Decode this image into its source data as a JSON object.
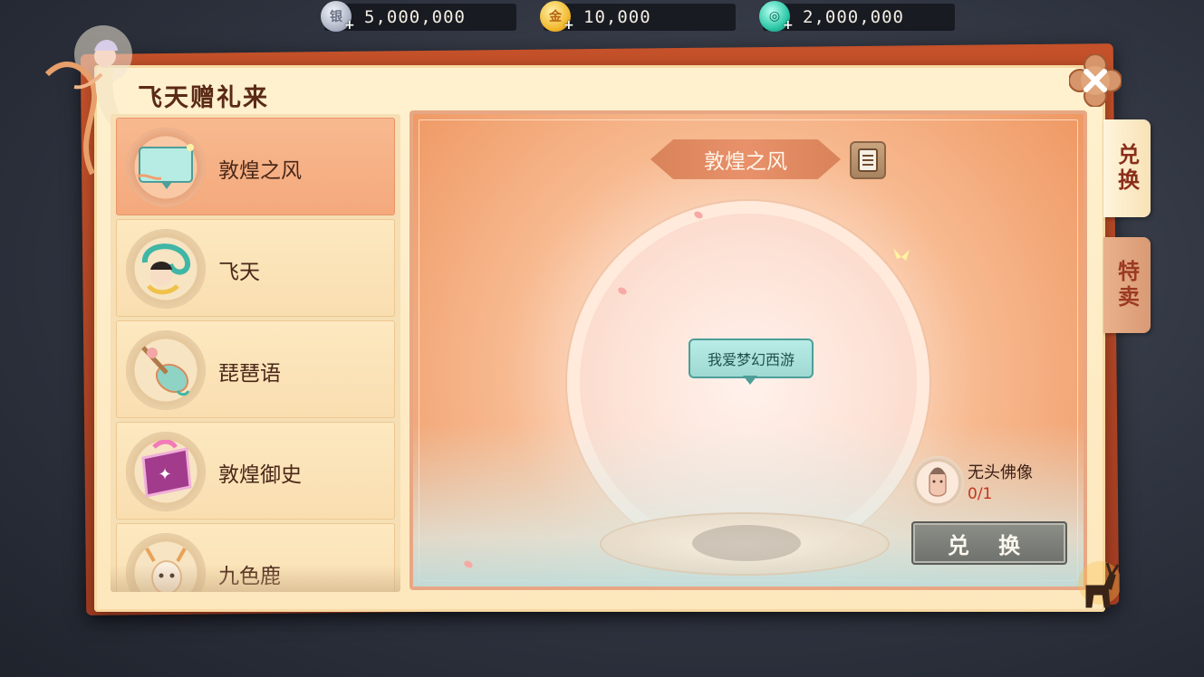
{
  "currencies": [
    {
      "name": "silver",
      "value": "5,000,000",
      "color": "#a7adc0"
    },
    {
      "name": "gold",
      "value": "10,000",
      "color": "#f2b72b"
    },
    {
      "name": "jade",
      "value": "2,000,000",
      "color": "#2ec9a8"
    }
  ],
  "window": {
    "title": "飞天赠礼来"
  },
  "side_tabs": [
    {
      "label": "兑换",
      "selected": true
    },
    {
      "label": "特卖",
      "selected": false
    }
  ],
  "items": [
    {
      "label": "敦煌之风",
      "selected": true,
      "icon": "chat-bubble-skin-icon"
    },
    {
      "label": "飞天",
      "selected": false,
      "icon": "flying-apsara-icon"
    },
    {
      "label": "琵琶语",
      "selected": false,
      "icon": "pipa-lute-icon"
    },
    {
      "label": "敦煌御史",
      "selected": false,
      "icon": "purple-seal-icon"
    },
    {
      "label": "九色鹿",
      "selected": false,
      "icon": "nine-color-deer-icon"
    }
  ],
  "preview": {
    "skin_name": "敦煌之风",
    "bubble_text": "我爱梦幻西游",
    "material_name": "无头佛像",
    "material_count": "0/1",
    "exchange_label": "兑 换"
  },
  "colors": {
    "accent": "#c4512a",
    "panel": "#fde7bd",
    "selected_item": "#f4a97c",
    "count_red": "#c2371d"
  }
}
